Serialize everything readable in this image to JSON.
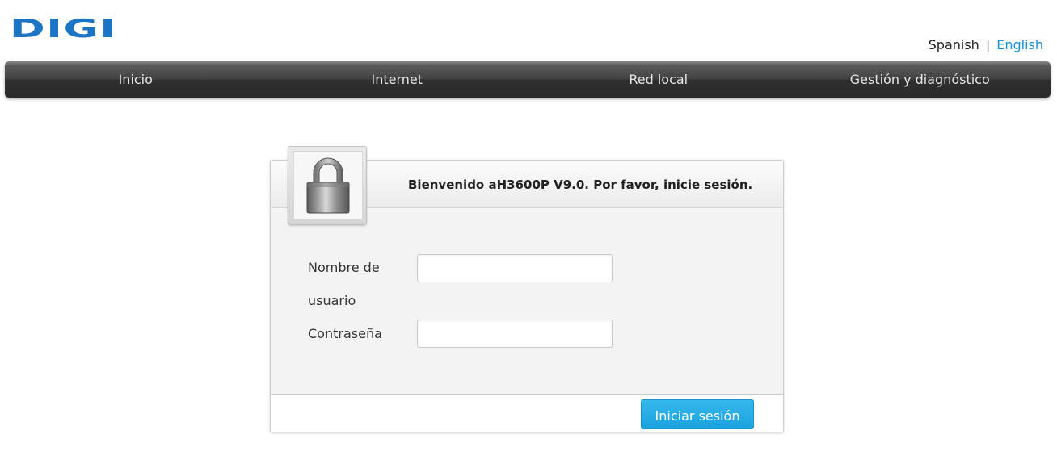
{
  "logo": {
    "text": "DIGI",
    "color": "#1c74c4"
  },
  "language": {
    "options": [
      "Spanish",
      "English"
    ],
    "separator": "|",
    "selected": "English"
  },
  "nav": {
    "items": [
      {
        "label": "Inicio"
      },
      {
        "label": "Internet"
      },
      {
        "label": "Red local"
      },
      {
        "label": "Gestión y diagnóstico"
      }
    ]
  },
  "login": {
    "welcome": "Bienvenido aH3600P V9.0. Por favor, inicie sesión.",
    "icon": "lock-icon",
    "username_label": "Nombre de usuario",
    "username_value": "",
    "password_label": "Contraseña",
    "password_value": "",
    "submit_label": "Iniciar sesión"
  },
  "colors": {
    "accent": "#1aa2df",
    "link": "#1a8fd6",
    "navbar": "#3a3a3a"
  }
}
